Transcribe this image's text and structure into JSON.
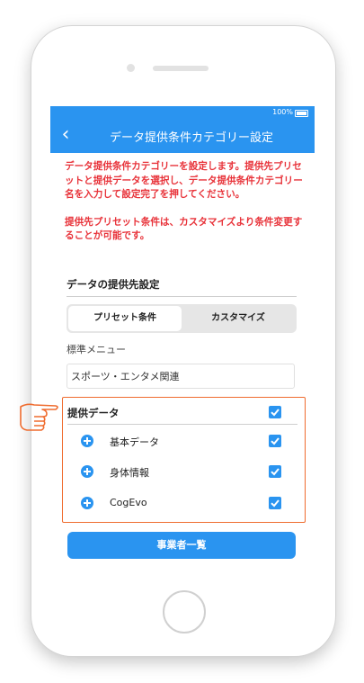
{
  "status": {
    "battery_text": "100%"
  },
  "nav": {
    "title": "データ提供条件カテゴリー設定",
    "back_glyph": "‹"
  },
  "notice": {
    "p1": "データ提供条件カテゴリーを設定します。提供先プリセットと提供データを選択し、データ提供条件カテゴリー名を入力して設定完了を押してください。",
    "p2": "提供先プリセット条件は、カスタマイズより条件変更することが可能です。"
  },
  "destination": {
    "title": "データの提供先設定",
    "segments": [
      "プリセット条件",
      "カスタマイズ"
    ],
    "standard_label": "標準メニュー",
    "standard_value": "スポーツ・エンタメ関連"
  },
  "provided": {
    "title": "提供データ",
    "items": [
      {
        "label": "基本データ"
      },
      {
        "label": "身体情報"
      },
      {
        "label": "CogEvo"
      }
    ]
  },
  "button": {
    "label": "事業者一覧"
  },
  "colors": {
    "accent": "#2a94f0",
    "notice": "#e8333a",
    "highlight": "#ef6c2f"
  }
}
